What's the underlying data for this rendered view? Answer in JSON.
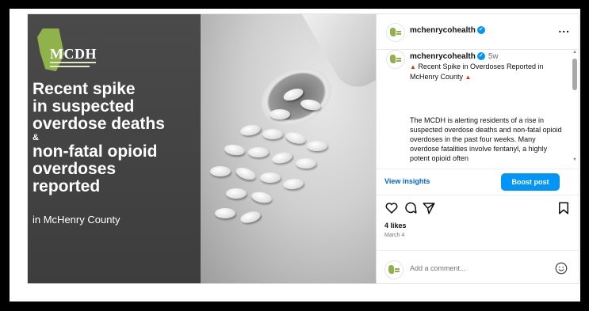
{
  "image": {
    "logo_text": "MCDH",
    "headline": {
      "line1": "Recent spike",
      "line2": "in suspected",
      "line3": "overdose deaths",
      "amp": "&",
      "line4": "non-fatal opioid",
      "line5": "overdoses",
      "line6": "reported"
    },
    "location": "in McHenry County"
  },
  "header": {
    "username": "mchenrycohealth",
    "more": "..."
  },
  "caption": {
    "username": "mchenrycohealth",
    "time": "5w",
    "title": "Recent Spike in Overdoses Reported in McHenry County",
    "body": "The MCDH is alerting residents of a rise in suspected overdose deaths and non-fatal opioid overdoses in the past four weeks. Many overdose fatalities involve fentanyl, a highly potent opioid often"
  },
  "insights": {
    "view_label": "View insights",
    "boost_label": "Boost post"
  },
  "engagement": {
    "likes": "4 likes",
    "date": "March 4"
  },
  "comment": {
    "placeholder": "Add a comment..."
  },
  "icons": [
    "heart-icon",
    "comment-icon",
    "share-icon",
    "bookmark-icon",
    "emoji-icon",
    "verified-icon",
    "flame-icon"
  ],
  "colors": {
    "accent": "#0095f6",
    "link": "#0064e0",
    "brand_green": "#8fb34a",
    "panel_gray": "#444444"
  }
}
